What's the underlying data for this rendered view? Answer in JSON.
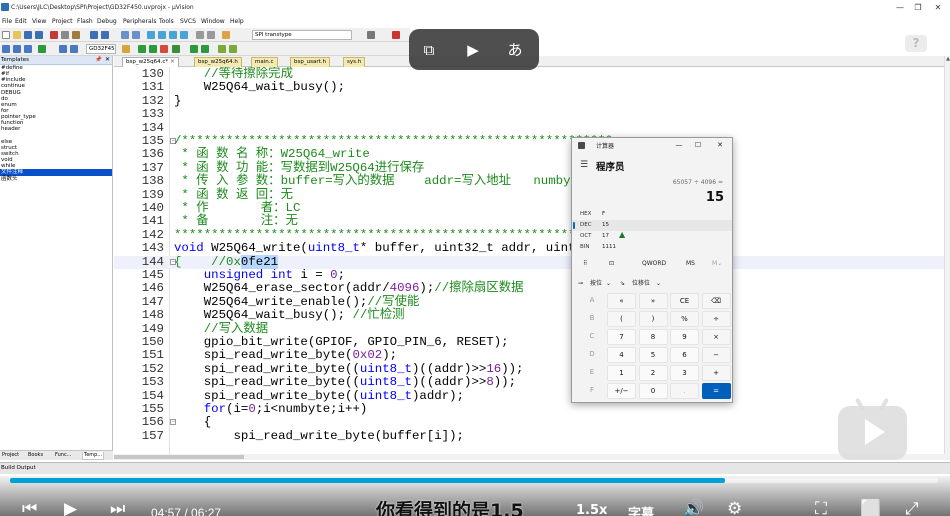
{
  "window": {
    "title": "C:\\Users\\JLC\\Desktop\\SPI\\Project\\GD32F450.uvprojx - µVision",
    "controls": {
      "minimize": "—",
      "restore": "❐",
      "close": "✕"
    }
  },
  "menu": [
    "File",
    "Edit",
    "View",
    "Project",
    "Flash",
    "Debug",
    "Peripherals",
    "Tools",
    "SVCS",
    "Window",
    "Help"
  ],
  "toolbar": {
    "search_combo": "SPI transtype",
    "target_combo": "GD32F450"
  },
  "left_panel": {
    "title": "Templates",
    "items": [
      "#define",
      "#if",
      "#include",
      "continue",
      "DEBUG",
      "do",
      "enum",
      "for",
      "pointer_type",
      "function",
      "header",
      "",
      "else",
      "struct",
      "switch",
      "void",
      "while",
      "文件注释",
      "函数头"
    ],
    "selected_index": 17,
    "bottom_tabs": [
      "Project",
      "Books",
      "Func...",
      "Temp..."
    ],
    "active_tab": 3
  },
  "file_tabs": [
    "bsp_w25q64.c*",
    "bsp_w25q64.h",
    "main.c",
    "bsp_usart.h",
    "sys.h"
  ],
  "active_file_tab": 0,
  "editor": {
    "lines": [
      {
        "n": "130",
        "segs": [
          {
            "t": "    //等待擦除完成",
            "c": "comment"
          }
        ]
      },
      {
        "n": "131",
        "segs": [
          {
            "t": "    W25Q64_wait_busy();",
            "c": "plain"
          }
        ]
      },
      {
        "n": "132",
        "segs": [
          {
            "t": "}",
            "c": "plain"
          }
        ]
      },
      {
        "n": "133",
        "segs": []
      },
      {
        "n": "134",
        "segs": []
      },
      {
        "n": "135",
        "fold": "⊟",
        "segs": [
          {
            "t": "/**********************************************************",
            "c": "comment"
          }
        ]
      },
      {
        "n": "136",
        "segs": [
          {
            "t": " * 函 数 名 称：W25Q64_write",
            "c": "comment"
          }
        ]
      },
      {
        "n": "137",
        "segs": [
          {
            "t": " * 函 数 功 能：写数据到W25Q64进行保存",
            "c": "comment"
          }
        ]
      },
      {
        "n": "138",
        "segs": [
          {
            "t": " * 传 入 参 数：buffer=写入的数据    addr=写入地址   numbyte",
            "c": "comment"
          }
        ]
      },
      {
        "n": "139",
        "segs": [
          {
            "t": " * 函 数 返 回：无",
            "c": "comment"
          }
        ]
      },
      {
        "n": "140",
        "segs": [
          {
            "t": " * 作       者：LC",
            "c": "comment"
          }
        ]
      },
      {
        "n": "141",
        "segs": [
          {
            "t": " * 备       注：无",
            "c": "comment"
          }
        ]
      },
      {
        "n": "142",
        "segs": [
          {
            "t": "**********************************************************/",
            "c": "comment"
          }
        ]
      },
      {
        "n": "143",
        "segs": [
          {
            "t": "void",
            "c": "keyword"
          },
          {
            "t": " W25Q64_write(",
            "c": "plain"
          },
          {
            "t": "uint8_t",
            "c": "keyword"
          },
          {
            "t": "* buffer, uint32_t addr, uint16_t",
            "c": "plain"
          }
        ]
      },
      {
        "n": "144",
        "fold": "⊟",
        "hl": true,
        "segs": [
          {
            "t": "{    //0x",
            "c": "comment"
          },
          {
            "t": "0fe21",
            "c": "sel"
          }
        ]
      },
      {
        "n": "145",
        "segs": [
          {
            "t": "    ",
            "c": "plain"
          },
          {
            "t": "unsigned int",
            "c": "keyword"
          },
          {
            "t": " i = ",
            "c": "plain"
          },
          {
            "t": "0",
            "c": "number"
          },
          {
            "t": ";",
            "c": "plain"
          }
        ]
      },
      {
        "n": "146",
        "segs": [
          {
            "t": "    W25Q64_erase_sector(addr/",
            "c": "plain"
          },
          {
            "t": "4096",
            "c": "number"
          },
          {
            "t": ");",
            "c": "plain"
          },
          {
            "t": "//擦除扇区数据",
            "c": "comment"
          }
        ]
      },
      {
        "n": "147",
        "segs": [
          {
            "t": "    W25Q64_write_enable();",
            "c": "plain"
          },
          {
            "t": "//写使能",
            "c": "comment"
          }
        ]
      },
      {
        "n": "148",
        "segs": [
          {
            "t": "    W25Q64_wait_busy(); ",
            "c": "plain"
          },
          {
            "t": "//忙检测",
            "c": "comment"
          }
        ]
      },
      {
        "n": "149",
        "segs": [
          {
            "t": "    //写入数据",
            "c": "comment"
          }
        ]
      },
      {
        "n": "150",
        "segs": [
          {
            "t": "    gpio_bit_write(GPIOF, GPIO_PIN_6, RESET);",
            "c": "plain"
          }
        ]
      },
      {
        "n": "151",
        "segs": [
          {
            "t": "    spi_read_write_byte(",
            "c": "plain"
          },
          {
            "t": "0x02",
            "c": "number"
          },
          {
            "t": ");",
            "c": "plain"
          }
        ]
      },
      {
        "n": "152",
        "segs": [
          {
            "t": "    spi_read_write_byte((",
            "c": "plain"
          },
          {
            "t": "uint8_t",
            "c": "keyword"
          },
          {
            "t": ")((addr)>>",
            "c": "plain"
          },
          {
            "t": "16",
            "c": "number"
          },
          {
            "t": "));",
            "c": "plain"
          }
        ]
      },
      {
        "n": "153",
        "segs": [
          {
            "t": "    spi_read_write_byte((",
            "c": "plain"
          },
          {
            "t": "uint8_t",
            "c": "keyword"
          },
          {
            "t": ")((addr)>>",
            "c": "plain"
          },
          {
            "t": "8",
            "c": "number"
          },
          {
            "t": "));",
            "c": "plain"
          }
        ]
      },
      {
        "n": "154",
        "segs": [
          {
            "t": "    spi_read_write_byte((",
            "c": "plain"
          },
          {
            "t": "uint8_t",
            "c": "keyword"
          },
          {
            "t": ")addr);",
            "c": "plain"
          }
        ]
      },
      {
        "n": "155",
        "segs": [
          {
            "t": "    ",
            "c": "plain"
          },
          {
            "t": "for",
            "c": "keyword"
          },
          {
            "t": "(i=",
            "c": "plain"
          },
          {
            "t": "0",
            "c": "number"
          },
          {
            "t": ";i<numbyte;i++)",
            "c": "plain"
          }
        ]
      },
      {
        "n": "156",
        "fold": "⊟",
        "segs": [
          {
            "t": "    {",
            "c": "plain"
          }
        ]
      },
      {
        "n": "157",
        "segs": [
          {
            "t": "        spi_read_write_byte(buffer[i]);",
            "c": "plain"
          }
        ]
      }
    ]
  },
  "output_bar": {
    "title": "Build Output"
  },
  "calculator": {
    "title": "计算器",
    "mode": "程序员",
    "expression": "65057 ÷ 4096 =",
    "result": "15",
    "radix": [
      {
        "label": "HEX",
        "value": "F"
      },
      {
        "label": "DEC",
        "value": "15"
      },
      {
        "label": "OCT",
        "value": "17"
      },
      {
        "label": "BIN",
        "value": "1111"
      }
    ],
    "active_radix": 1,
    "word_size": "QWORD",
    "memory": [
      "MS",
      "M⌄"
    ],
    "bitwise_label": "按位",
    "bitshift_label": "位移位",
    "keys": [
      [
        "A",
        "«",
        "»",
        "CE",
        "⌫"
      ],
      [
        "B",
        "(",
        ")",
        "%",
        "÷"
      ],
      [
        "C",
        "7",
        "8",
        "9",
        "×"
      ],
      [
        "D",
        "4",
        "5",
        "6",
        "−"
      ],
      [
        "E",
        "1",
        "2",
        "3",
        "+"
      ],
      [
        "F",
        "+/−",
        "0",
        ".",
        "="
      ]
    ]
  },
  "video": {
    "time_current": "04:57",
    "time_total": "06:27",
    "progress_fraction": 0.77,
    "subtitle": "你看得到的是1.5",
    "speed": "1.5x",
    "captions": "字幕"
  },
  "colors": {
    "accent": "#00a1d6",
    "calc_equals": "#005fb8",
    "comment": "#1d8a1d",
    "keyword": "#0000ff"
  }
}
